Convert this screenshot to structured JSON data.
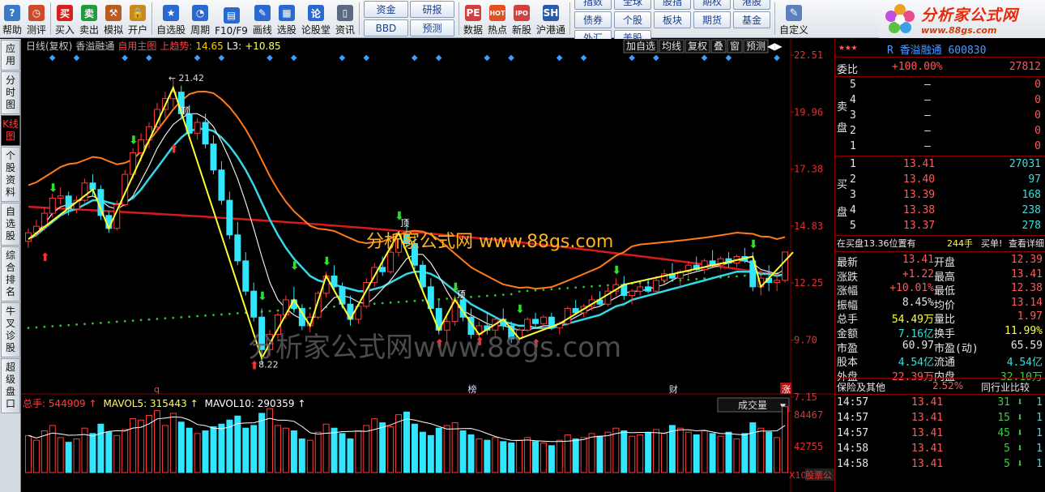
{
  "toolbar": {
    "group1": [
      {
        "label": "帮助",
        "icon": "?"
      },
      {
        "label": "测评",
        "icon": "◷"
      }
    ],
    "group2": [
      {
        "label": "买入",
        "icon": "买"
      },
      {
        "label": "卖出",
        "icon": "卖"
      },
      {
        "label": "模拟",
        "icon": "⚒"
      },
      {
        "label": "开户",
        "icon": "🔒"
      }
    ],
    "group3": [
      {
        "label": "自选股",
        "icon": "★"
      },
      {
        "label": "周期",
        "icon": "◔"
      },
      {
        "label": "F10/F9",
        "icon": "▤"
      },
      {
        "label": "画线",
        "icon": "✎"
      },
      {
        "label": "选股",
        "icon": "▦"
      },
      {
        "label": "论股堂",
        "icon": "论"
      },
      {
        "label": "资讯",
        "icon": "▯"
      }
    ],
    "grid_a": [
      "资金",
      "研报",
      "BBD",
      "预测"
    ],
    "group4": [
      {
        "label": "数据",
        "icon": "PE"
      },
      {
        "label": "热点",
        "icon": "HOT"
      },
      {
        "label": "新股",
        "icon": "IPO"
      },
      {
        "label": "沪港通",
        "icon": "SH"
      }
    ],
    "grid_b": [
      "指数",
      "全球",
      "股指",
      "期权",
      "港股",
      "债券",
      "个股",
      "板块",
      "期货",
      "基金",
      "外汇",
      "美股"
    ],
    "custom": "自定义"
  },
  "logo": {
    "title": "分析家公式网",
    "url": "www.88gs.com"
  },
  "leftbar": [
    "应用",
    "分时图",
    "K线图",
    "个股资料",
    "自选股",
    "综合排名",
    "牛叉诊股",
    "超级盘口"
  ],
  "chart": {
    "title": "日线(复权)",
    "name": "香溢融通",
    "main": "自用主图",
    "trend": "上趋势:",
    "trend_val": "14.65",
    "l3": "L3:",
    "l3_val": "+10.85",
    "buttons": [
      "加自选",
      "均线",
      "复权",
      "叠",
      "窗",
      "预测"
    ],
    "y_labels": [
      "22.51",
      "19.96",
      "17.38",
      "14.83",
      "12.25",
      "9.70",
      "7.15"
    ],
    "annotations": {
      "high": "21.42",
      "low": "8.22",
      "q": "q",
      "bang": "榜",
      "cai": "财",
      "zhang": "涨",
      "ding1": "顶",
      "ding2": "顶",
      "ding3": "顶"
    },
    "watermark1": "分析家公式网  www.88gs.com",
    "watermark2": "分析家公式网www.88gs.com",
    "vol_label": "总手: 544909",
    "mavol5": "MAVOL5: 315443",
    "mavol10": "MAVOL10: 290359",
    "vol_sel": "成交量",
    "vol_y": [
      "84467",
      "42755"
    ],
    "vol_unit": "X10",
    "footer": "股票公式指标软件下载[分析家公式网www.88gs.com]"
  },
  "chart_data": {
    "type": "candlestick",
    "ylim": [
      7.15,
      22.51
    ],
    "ohlc": [
      [
        13.9,
        14.5,
        13.6,
        14.3
      ],
      [
        14.3,
        14.9,
        14.1,
        14.6
      ],
      [
        14.6,
        15.5,
        14.4,
        15.2
      ],
      [
        15.2,
        16.1,
        15.0,
        15.9
      ],
      [
        15.9,
        16.4,
        15.6,
        16.0
      ],
      [
        16.0,
        16.2,
        15.1,
        15.4
      ],
      [
        15.4,
        16.0,
        15.2,
        15.8
      ],
      [
        15.8,
        16.8,
        15.7,
        16.6
      ],
      [
        16.6,
        17.0,
        16.0,
        16.3
      ],
      [
        16.3,
        16.5,
        14.9,
        15.1
      ],
      [
        15.1,
        15.3,
        14.3,
        14.5
      ],
      [
        14.5,
        15.8,
        14.4,
        15.6
      ],
      [
        15.6,
        17.2,
        15.5,
        17.0
      ],
      [
        17.0,
        18.2,
        16.8,
        18.0
      ],
      [
        18.0,
        18.9,
        17.6,
        18.6
      ],
      [
        18.6,
        19.4,
        18.2,
        19.2
      ],
      [
        19.2,
        20.3,
        19.0,
        20.0
      ],
      [
        20.0,
        20.8,
        19.6,
        20.5
      ],
      [
        20.5,
        21.42,
        20.1,
        20.8
      ],
      [
        20.8,
        21.1,
        19.5,
        19.8
      ],
      [
        19.8,
        20.2,
        18.6,
        18.9
      ],
      [
        18.9,
        19.6,
        18.6,
        19.4
      ],
      [
        19.4,
        19.8,
        18.2,
        18.4
      ],
      [
        18.4,
        18.8,
        17.0,
        17.2
      ],
      [
        17.2,
        17.6,
        15.6,
        15.8
      ],
      [
        15.8,
        16.2,
        14.0,
        14.2
      ],
      [
        14.2,
        14.8,
        12.8,
        13.0
      ],
      [
        13.0,
        13.4,
        11.4,
        11.6
      ],
      [
        11.6,
        12.0,
        10.2,
        10.4
      ],
      [
        10.4,
        10.8,
        8.22,
        8.9
      ],
      [
        8.9,
        9.8,
        8.6,
        9.6
      ],
      [
        9.6,
        10.6,
        9.4,
        10.5
      ],
      [
        10.5,
        11.4,
        10.3,
        11.2
      ],
      [
        11.2,
        11.8,
        10.6,
        10.8
      ],
      [
        10.8,
        11.0,
        9.8,
        10.0
      ],
      [
        10.0,
        10.6,
        9.7,
        10.4
      ],
      [
        10.4,
        11.6,
        10.3,
        11.5
      ],
      [
        11.5,
        12.5,
        11.3,
        12.3
      ],
      [
        12.3,
        12.8,
        11.6,
        11.8
      ],
      [
        11.8,
        12.0,
        10.8,
        11.0
      ],
      [
        11.0,
        11.4,
        10.0,
        10.3
      ],
      [
        10.3,
        11.0,
        10.1,
        10.9
      ],
      [
        10.9,
        12.2,
        10.8,
        12.0
      ],
      [
        12.0,
        12.9,
        11.8,
        12.7
      ],
      [
        12.7,
        13.2,
        12.3,
        12.5
      ],
      [
        12.5,
        13.6,
        12.4,
        13.4
      ],
      [
        13.4,
        14.4,
        13.2,
        14.2
      ],
      [
        14.2,
        14.9,
        13.6,
        13.8
      ],
      [
        13.8,
        14.2,
        12.6,
        12.8
      ],
      [
        12.8,
        13.0,
        11.6,
        11.8
      ],
      [
        11.8,
        12.2,
        10.6,
        10.8
      ],
      [
        10.8,
        11.2,
        9.6,
        9.8
      ],
      [
        9.8,
        10.4,
        9.2,
        10.2
      ],
      [
        10.2,
        11.4,
        10.0,
        11.2
      ],
      [
        11.2,
        11.6,
        10.2,
        10.4
      ],
      [
        10.4,
        10.8,
        9.4,
        9.6
      ],
      [
        9.6,
        10.2,
        9.3,
        10.0
      ],
      [
        10.0,
        10.6,
        9.6,
        9.8
      ],
      [
        9.8,
        10.4,
        9.5,
        10.3
      ],
      [
        10.3,
        10.8,
        9.8,
        10.0
      ],
      [
        10.0,
        10.2,
        9.2,
        9.4
      ],
      [
        9.4,
        9.9,
        9.2,
        9.8
      ],
      [
        9.8,
        10.4,
        9.7,
        10.3
      ],
      [
        10.3,
        10.6,
        9.9,
        10.1
      ],
      [
        10.1,
        10.5,
        9.8,
        10.4
      ],
      [
        10.4,
        10.6,
        9.8,
        9.9
      ],
      [
        9.9,
        10.2,
        9.6,
        10.1
      ],
      [
        10.1,
        10.9,
        10.0,
        10.8
      ],
      [
        10.8,
        11.2,
        10.5,
        10.6
      ],
      [
        10.6,
        11.0,
        10.4,
        10.9
      ],
      [
        10.9,
        11.4,
        10.7,
        11.2
      ],
      [
        11.2,
        11.6,
        10.9,
        11.0
      ],
      [
        11.0,
        11.8,
        10.9,
        11.6
      ],
      [
        11.6,
        12.2,
        11.4,
        11.9
      ],
      [
        11.9,
        12.3,
        11.2,
        11.4
      ],
      [
        11.4,
        11.7,
        11.0,
        11.6
      ],
      [
        11.6,
        12.0,
        11.4,
        11.8
      ],
      [
        11.8,
        12.2,
        11.5,
        11.6
      ],
      [
        11.6,
        12.3,
        11.5,
        12.1
      ],
      [
        12.1,
        12.6,
        11.9,
        12.4
      ],
      [
        12.4,
        12.9,
        12.1,
        12.2
      ],
      [
        12.2,
        12.6,
        11.8,
        12.5
      ],
      [
        12.5,
        13.0,
        12.2,
        12.8
      ],
      [
        12.8,
        13.2,
        12.5,
        12.6
      ],
      [
        12.6,
        13.1,
        12.4,
        13.0
      ],
      [
        13.0,
        13.5,
        12.7,
        12.8
      ],
      [
        12.8,
        13.2,
        12.6,
        13.1
      ],
      [
        13.1,
        13.4,
        12.7,
        12.9
      ],
      [
        12.9,
        13.3,
        12.7,
        13.2
      ],
      [
        13.2,
        13.6,
        12.9,
        13.0
      ],
      [
        13.0,
        13.4,
        11.6,
        11.8
      ],
      [
        11.8,
        12.6,
        11.4,
        12.2
      ],
      [
        12.2,
        12.8,
        11.6,
        12.0
      ],
      [
        12.0,
        12.4,
        11.6,
        12.1
      ],
      [
        12.1,
        13.41,
        12.0,
        13.41
      ]
    ],
    "vol": [
      55,
      48,
      62,
      70,
      52,
      45,
      50,
      66,
      58,
      72,
      60,
      55,
      64,
      80,
      78,
      85,
      92,
      70,
      88,
      75,
      66,
      58,
      62,
      68,
      72,
      78,
      84,
      66,
      70,
      88,
      95,
      70,
      66,
      62,
      50,
      48,
      60,
      72,
      66,
      58,
      50,
      62,
      70,
      80,
      74,
      68,
      86,
      90,
      72,
      60,
      55,
      66,
      70,
      74,
      62,
      56,
      50,
      48,
      52,
      46,
      44,
      48,
      52,
      46,
      44,
      40,
      48,
      56,
      50,
      52,
      58,
      54,
      60,
      66,
      62,
      54,
      56,
      60,
      64,
      58,
      70,
      66,
      60,
      56,
      62,
      58,
      54,
      60,
      50,
      58,
      74,
      66,
      60,
      52,
      98
    ],
    "ma_white": [
      13.9,
      14.3,
      14.7,
      15.2,
      15.5,
      15.6,
      15.7,
      15.9,
      16.0,
      15.8,
      15.5,
      15.4,
      15.6,
      16.0,
      16.7,
      17.4,
      18.2,
      18.8,
      19.3,
      19.6,
      19.8,
      19.8,
      19.6,
      19.2,
      18.5,
      17.7,
      16.8,
      15.7,
      14.5,
      13.2,
      12.0,
      11.2,
      10.8,
      10.5,
      10.3,
      10.3,
      10.5,
      10.9,
      11.3,
      11.4,
      11.3,
      11.1,
      11.0,
      11.3,
      11.7,
      12.1,
      12.6,
      13.1,
      13.3,
      13.3,
      12.9,
      12.3,
      11.6,
      11.0,
      10.7,
      10.5,
      10.3,
      10.1,
      10.0,
      10.0,
      9.9,
      9.8,
      9.8,
      9.9,
      10.0,
      10.0,
      10.1,
      10.2,
      10.4,
      10.6,
      10.8,
      10.9,
      11.1,
      11.3,
      11.5,
      11.6,
      11.6,
      11.7,
      11.8,
      11.9,
      12.1,
      12.3,
      12.4,
      12.5,
      12.6,
      12.7,
      12.8,
      12.9,
      13.0,
      13.0,
      12.9,
      12.6,
      12.5,
      12.4,
      12.6
    ],
    "ma_cyan": [
      14.0,
      14.2,
      14.5,
      14.8,
      15.1,
      15.3,
      15.4,
      15.6,
      15.8,
      15.8,
      15.7,
      15.6,
      15.7,
      15.9,
      16.3,
      16.8,
      17.3,
      17.8,
      18.3,
      18.7,
      19.0,
      19.1,
      19.1,
      19.0,
      18.7,
      18.3,
      17.8,
      17.2,
      16.5,
      15.7,
      14.9,
      14.2,
      13.6,
      13.1,
      12.7,
      12.3,
      12.1,
      12.0,
      11.9,
      11.8,
      11.7,
      11.6,
      11.6,
      11.7,
      11.8,
      12.0,
      12.2,
      12.4,
      12.5,
      12.5,
      12.4,
      12.2,
      11.9,
      11.6,
      11.3,
      11.0,
      10.8,
      10.6,
      10.4,
      10.2,
      10.1,
      10.0,
      10.0,
      9.9,
      9.9,
      9.9,
      10.0,
      10.1,
      10.2,
      10.3,
      10.4,
      10.5,
      10.7,
      10.9,
      11.0,
      11.2,
      11.3,
      11.4,
      11.5,
      11.6,
      11.7,
      11.8,
      11.9,
      12.0,
      12.1,
      12.2,
      12.3,
      12.4,
      12.5,
      12.5,
      12.5,
      12.4,
      12.4,
      12.3,
      12.4
    ]
  },
  "panel": {
    "stars": "★★★",
    "code_name": "R 香溢融通 600830",
    "weibi": {
      "label": "委比",
      "pct": "+100.00%",
      "num": "27812"
    },
    "sell": [
      {
        "n": "5",
        "p": "–",
        "v": "0"
      },
      {
        "n": "4",
        "p": "–",
        "v": "0"
      },
      {
        "n": "3",
        "p": "–",
        "v": "0"
      },
      {
        "n": "2",
        "p": "–",
        "v": "0"
      },
      {
        "n": "1",
        "p": "–",
        "v": "0"
      }
    ],
    "buy": [
      {
        "n": "1",
        "p": "13.41",
        "v": "27031"
      },
      {
        "n": "2",
        "p": "13.40",
        "v": "97"
      },
      {
        "n": "3",
        "p": "13.39",
        "v": "168"
      },
      {
        "n": "4",
        "p": "13.38",
        "v": "238"
      },
      {
        "n": "5",
        "p": "13.37",
        "v": "278"
      }
    ],
    "sell_label": [
      "卖",
      "盘"
    ],
    "buy_label": [
      "买",
      "盘"
    ],
    "queue": {
      "text": "在买盘13.36位置有",
      "vol": "244手",
      "action": "买单!",
      "detail": "查看详细"
    },
    "quote": [
      {
        "l1": "最新",
        "v1": "13.41",
        "c1": "red",
        "l2": "开盘",
        "v2": "12.39",
        "c2": "red"
      },
      {
        "l1": "涨跌",
        "v1": "+1.22",
        "c1": "red",
        "l2": "最高",
        "v2": "13.41",
        "c2": "red"
      },
      {
        "l1": "涨幅",
        "v1": "+10.01%",
        "c1": "red",
        "l2": "最低",
        "v2": "12.38",
        "c2": "red"
      },
      {
        "l1": "振幅",
        "v1": "8.45%",
        "c1": "wht",
        "l2": "均价",
        "v2": "13.14",
        "c2": "red"
      },
      {
        "l1": "总手",
        "v1": "54.49万",
        "c1": "yel",
        "l2": "量比",
        "v2": "1.97",
        "c2": "red"
      },
      {
        "l1": "金额",
        "v1": "7.16亿",
        "c1": "cyan",
        "l2": "换手",
        "v2": "11.99%",
        "c2": "yel"
      },
      {
        "l1": "市盈",
        "v1": "60.97",
        "c1": "wht",
        "l2": "市盈(动)",
        "v2": "65.59",
        "c2": "wht"
      },
      {
        "l1": "股本",
        "v1": "4.54亿",
        "c1": "cyan",
        "l2": "流通",
        "v2": "4.54亿",
        "c2": "cyan"
      },
      {
        "l1": "外盘",
        "v1": "22.39万",
        "c1": "red",
        "l2": "内盘",
        "v2": "32.10万",
        "c2": "grn"
      }
    ],
    "industry": {
      "label": "保险及其他",
      "pct": "2.52%",
      "compare": "同行业比较"
    },
    "ticks": [
      {
        "t": "14:57",
        "p": "13.41",
        "v": "31",
        "d": "1"
      },
      {
        "t": "14:57",
        "p": "13.41",
        "v": "15",
        "d": "1"
      },
      {
        "t": "14:57",
        "p": "13.41",
        "v": "45",
        "d": "1"
      },
      {
        "t": "14:58",
        "p": "13.41",
        "v": "5",
        "d": "1"
      },
      {
        "t": "14:58",
        "p": "13.41",
        "v": "5",
        "d": "1"
      }
    ]
  }
}
